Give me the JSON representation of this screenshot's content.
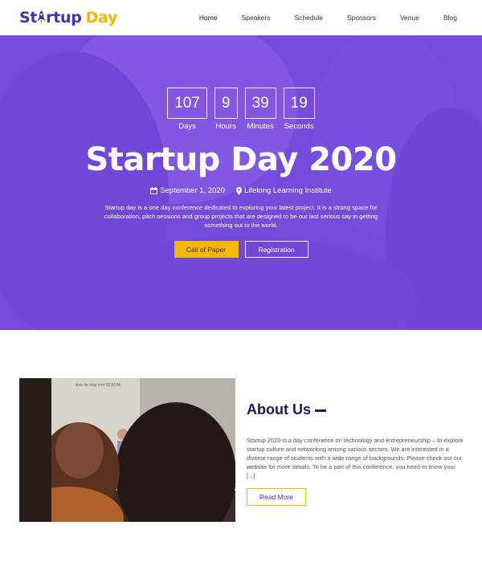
{
  "brand": {
    "logo_part1": "St",
    "logo_part1b": "rtup",
    "logo_part2": "Day",
    "primary_color": "#3d35b8",
    "accent_color": "#f2b705"
  },
  "nav": {
    "items": [
      {
        "label": "Home"
      },
      {
        "label": "Speakers"
      },
      {
        "label": "Schedule"
      },
      {
        "label": "Sponsors"
      },
      {
        "label": "Venue"
      },
      {
        "label": "Blog"
      }
    ],
    "active": "Home"
  },
  "hero": {
    "overlay_color": "#7c4dff",
    "countdown": [
      {
        "value": "107",
        "label": "Days"
      },
      {
        "value": "9",
        "label": "Hours"
      },
      {
        "value": "39",
        "label": "Minutes"
      },
      {
        "value": "19",
        "label": "Seconds"
      }
    ],
    "title": "Startup Day 2020",
    "date_icon": "calendar-icon",
    "date": "September 1, 2020",
    "location_icon": "map-marker-icon",
    "location": "Lifelong Learning Institute",
    "description": "Startup day is a one day conference dedicated to exploring your latest project. It is a strong space for collaboration, pitch sessions and group projects that are designed to be our last serious say in getting something out to the world.",
    "primary_button": "Call of Paper",
    "secondary_button": "Registration",
    "button_color": "#f5b800"
  },
  "about": {
    "title": "About Us",
    "text": "Startup 2020 is a day conference on technology and entrepreneurship – to explore startup culture and networking among various sectors. We are interested in a diverse range of students with a wide range of backgrounds. Please check out our website for more details. To be a part of this conference, you need to know your [...]",
    "button": "Read More",
    "slide_text": "Aan de slag met SCRUM"
  }
}
